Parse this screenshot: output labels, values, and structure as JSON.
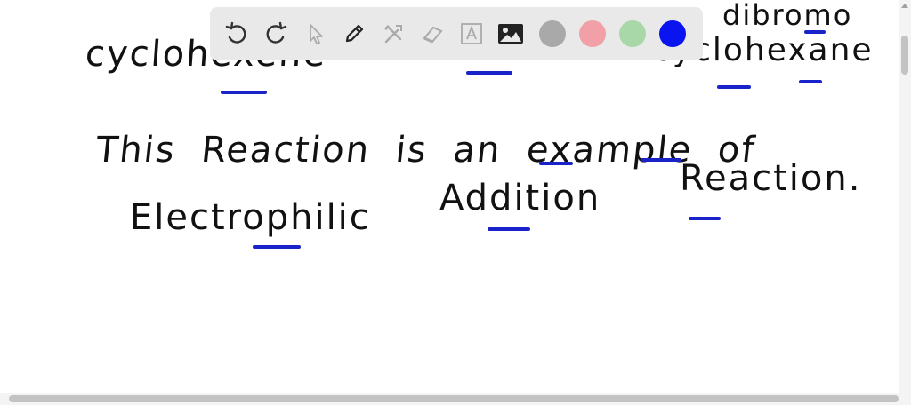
{
  "whiteboard": {
    "line1_left": "cyclohexene",
    "line1_right_a": "dibromo",
    "line1_right_b": "cyclohexane",
    "line2": "This  Reaction  is  an  example  of",
    "line3_a": "Electrophilic",
    "line3_b": "Addition",
    "line3_c": "Reaction.",
    "ink_color": "#111111",
    "underline_color": "#1a22c9"
  },
  "toolbar": {
    "tools": [
      {
        "name": "undo-icon"
      },
      {
        "name": "redo-icon"
      },
      {
        "name": "select-icon"
      },
      {
        "name": "pen-icon"
      },
      {
        "name": "tools-icon"
      },
      {
        "name": "eraser-icon"
      },
      {
        "name": "text-icon"
      },
      {
        "name": "image-icon"
      }
    ],
    "colors": [
      {
        "name": "color-gray",
        "hex": "#a9a9a9"
      },
      {
        "name": "color-pink",
        "hex": "#f0a0a6"
      },
      {
        "name": "color-green",
        "hex": "#a8d8a8"
      },
      {
        "name": "color-blue",
        "hex": "#0a14f0",
        "selected": true
      }
    ]
  }
}
